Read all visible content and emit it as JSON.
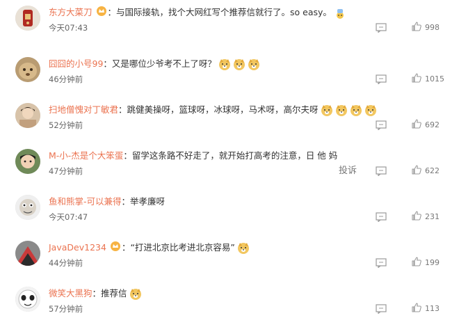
{
  "comments": [
    {
      "username": "东方大菜刀",
      "badge": "vip-crown-icon",
      "separator": "：",
      "text": "与国际接轨，找个大网红写个推荐信就行了。so easy。",
      "emojis": [
        "doge-icon-small"
      ],
      "time": "今天07:43",
      "likes": "998"
    },
    {
      "username": "囧囧的小号99",
      "separator": "：",
      "text": "又是哪位少爷考不上了呀？",
      "emojis": [
        "doge-icon",
        "doge-icon",
        "doge-icon"
      ],
      "time": "46分钟前",
      "likes": "1015"
    },
    {
      "username": "扫地僧愧对丁敏君",
      "separator": "：",
      "text": "跳健美操呀，篮球呀，冰球呀，马术呀，高尔夫呀",
      "emojis": [
        "doge-icon",
        "doge-icon",
        "doge-icon",
        "doge-icon"
      ],
      "time": "52分钟前",
      "likes": "692"
    },
    {
      "username": "M-小-杰是个大笨蛋",
      "separator": "：",
      "text": "留学这条路不好走了，就开始打高考的注意，日 他 妈",
      "emojis": [],
      "time": "47分钟前",
      "report_label": "投诉",
      "likes": "622"
    },
    {
      "username": "鱼和熊掌-可以兼得",
      "separator": "：",
      "text": "举孝廉呀",
      "emojis": [],
      "time": "今天07:47",
      "likes": "231"
    },
    {
      "username": "JavaDev1234",
      "badge": "vip-crown-icon",
      "separator": "：",
      "text": "“打进北京比考进北京容易”",
      "emojis": [
        "doge-icon"
      ],
      "time": "44分钟前",
      "likes": "199"
    },
    {
      "username": "微笑大黑狗",
      "separator": "：",
      "text": "推荐信",
      "emojis": [
        "doge-icon"
      ],
      "time": "57分钟前",
      "likes": "113"
    }
  ],
  "colors": {
    "username": "#eb7350",
    "text": "#333333",
    "meta": "#777777"
  }
}
